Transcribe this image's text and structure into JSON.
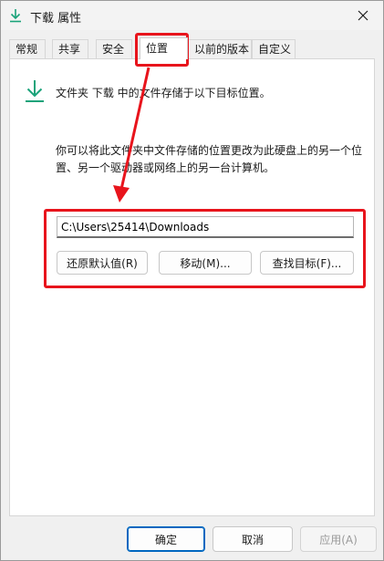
{
  "window": {
    "title": "下载 属性",
    "icon": "download-arrow-icon"
  },
  "tabs": [
    {
      "label": "常规",
      "active": false
    },
    {
      "label": "共享",
      "active": false
    },
    {
      "label": "安全",
      "active": false
    },
    {
      "label": "位置",
      "active": true
    },
    {
      "label": "以前的版本",
      "active": false
    },
    {
      "label": "自定义",
      "active": false
    }
  ],
  "location": {
    "header": "文件夹 下载 中的文件存储于以下目标位置。",
    "description": "你可以将此文件夹中文件存储的位置更改为此硬盘上的另一个位置、另一个驱动器或网络上的另一台计算机。",
    "path_value": "C:\\Users\\25414\\Downloads",
    "restore_default_label": "还原默认值(R)",
    "move_label": "移动(M)...",
    "find_target_label": "查找目标(F)..."
  },
  "footer": {
    "ok_label": "确定",
    "cancel_label": "取消",
    "apply_label": "应用(A)"
  },
  "colors": {
    "annotation": "#e8141c",
    "accent": "#0067c0",
    "icon_green": "#1aa37a"
  }
}
